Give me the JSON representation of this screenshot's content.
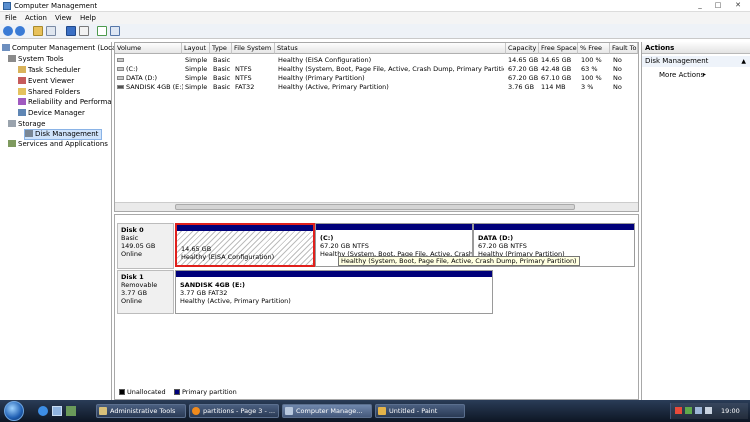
{
  "window": {
    "title": "Computer Management",
    "min": "_",
    "max": "□",
    "close": "✕"
  },
  "menu": [
    "File",
    "Action",
    "View",
    "Help"
  ],
  "tree": {
    "root": "Computer Management (Local",
    "system_tools": "System Tools",
    "task_scheduler": "Task Scheduler",
    "event_viewer": "Event Viewer",
    "shared_folders": "Shared Folders",
    "reliability": "Reliability and Performa",
    "device_manager": "Device Manager",
    "storage": "Storage",
    "disk_management": "Disk Management",
    "services": "Services and Applications"
  },
  "volumes": {
    "headers": [
      "Volume",
      "Layout",
      "Type",
      "File System",
      "Status",
      "Capacity",
      "Free Space",
      "% Free",
      "Fault To"
    ],
    "rows": [
      [
        "",
        "Simple",
        "Basic",
        "",
        "Healthy (EISA Configuration)",
        "14.65 GB",
        "14.65 GB",
        "100 %",
        "No"
      ],
      [
        "(C:)",
        "Simple",
        "Basic",
        "NTFS",
        "Healthy (System, Boot, Page File, Active, Crash Dump, Primary Partition)",
        "67.20 GB",
        "42.48 GB",
        "63 %",
        "No"
      ],
      [
        "DATA (D:)",
        "Simple",
        "Basic",
        "NTFS",
        "Healthy (Primary Partition)",
        "67.20 GB",
        "67.10 GB",
        "100 %",
        "No"
      ],
      [
        "SANDISK 4GB (E:)",
        "Simple",
        "Basic",
        "FAT32",
        "Healthy (Active, Primary Partition)",
        "3.76 GB",
        "114 MB",
        "3 %",
        "No"
      ]
    ]
  },
  "disks": {
    "disk0": {
      "name": "Disk 0",
      "type": "Basic",
      "size": "149.05 GB",
      "state": "Online",
      "p1": {
        "size": "14.65 GB",
        "status": "Healthy (EISA Configuration)"
      },
      "p2": {
        "name": "(C:)",
        "size": "67.20 GB NTFS",
        "status": "Healthy (System, Boot, Page File, Active, Crash Dump, Primary Partition)"
      },
      "p3": {
        "name": "DATA  (D:)",
        "size": "67.20 GB NTFS",
        "status": "Healthy (Primary Partition)"
      }
    },
    "disk1": {
      "name": "Disk 1",
      "type": "Removable",
      "size": "3.77 GB",
      "state": "Online",
      "p1": {
        "name": "SANDISK 4GB  (E:)",
        "size": "3.77 GB FAT32",
        "status": "Healthy (Active, Primary Partition)"
      }
    },
    "tooltip": "Healthy (System, Boot, Page File, Active, Crash Dump, Primary Partition)",
    "legend": {
      "unallocated": "Unallocated",
      "primary": "Primary partition"
    }
  },
  "actions": {
    "header": "Actions",
    "section": "Disk Management",
    "more": "More Actions"
  },
  "taskbar": {
    "items": [
      "Administrative Tools",
      "partitions - Page 3 - ...",
      "Computer Manage...",
      "Untitled - Paint"
    ],
    "clock": "19:00"
  },
  "colors": {
    "primary_partition": "#00007a",
    "selection_red": "#e0201c"
  }
}
